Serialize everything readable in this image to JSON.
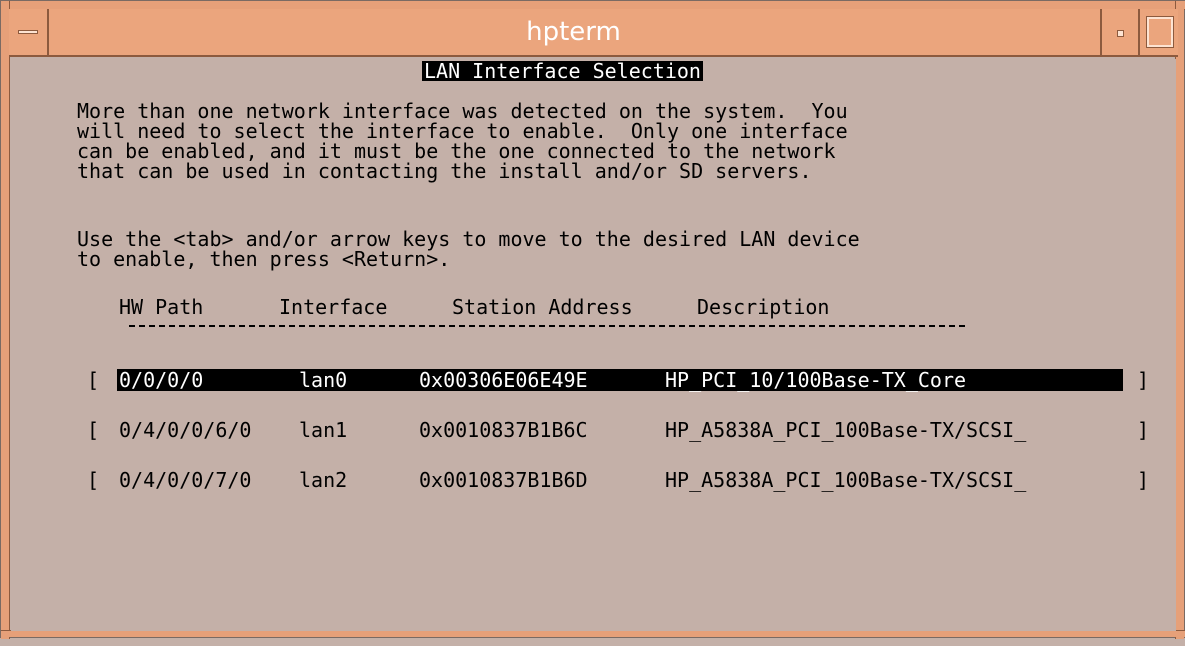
{
  "window": {
    "title": "hpterm"
  },
  "screen": {
    "heading": "LAN Interface Selection",
    "paragraph1": [
      "More than one network interface was detected on the system.  You",
      "will need to select the interface to enable.  Only one interface",
      "can be enabled, and it must be the one connected to the network",
      "that can be used in contacting the install and/or SD servers."
    ],
    "paragraph2": [
      "Use the <tab> and/or arrow keys to move to the desired LAN device",
      "to enable, then press <Return>."
    ],
    "columns": {
      "hw_path": "HW Path",
      "interface": "Interface",
      "station_address": "Station Address",
      "description": "Description"
    },
    "rows": [
      {
        "hw_path": "0/0/0/0",
        "interface": "lan0",
        "station_address": "0x00306E06E49E",
        "description": "HP_PCI_10/100Base-TX_Core",
        "selected": true
      },
      {
        "hw_path": "0/4/0/0/6/0",
        "interface": "lan1",
        "station_address": "0x0010837B1B6C",
        "description": "HP_A5838A_PCI_100Base-TX/SCSI_",
        "selected": false
      },
      {
        "hw_path": "0/4/0/0/7/0",
        "interface": "lan2",
        "station_address": "0x0010837B1B6D",
        "description": "HP_A5838A_PCI_100Base-TX/SCSI_",
        "selected": false
      }
    ],
    "bracket_open": "[",
    "bracket_close": "]"
  },
  "colors": {
    "titlebar": "#eba57d",
    "background": "#c4b0a8",
    "highlight": "#000000"
  },
  "icons": {
    "window_menu": "window-menu-icon",
    "minimize": "minimize-icon",
    "maximize": "maximize-icon"
  }
}
